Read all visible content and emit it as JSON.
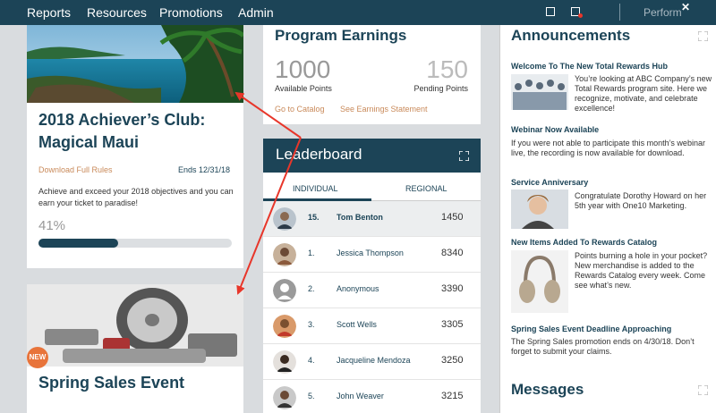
{
  "nav": {
    "items": [
      "Reports",
      "Resources",
      "Promotions",
      "Admin"
    ],
    "brand": "Perform"
  },
  "achiever": {
    "title": "2018 Achiever’s Club: Magical Maui",
    "download_link": "Download Full Rules",
    "ends": "Ends 12/31/18",
    "description": "Achieve and exceed your 2018 objectives and you can earn your ticket to paradise!",
    "percent_label": "41%",
    "progress": 0.41
  },
  "spring_card": {
    "title": "Spring Sales Event",
    "badge": "NEW"
  },
  "earnings": {
    "title": "Program Earnings",
    "available_value": "1000",
    "available_label": "Available Points",
    "pending_value": "150",
    "pending_label": "Pending Points",
    "catalog_link": "Go to Catalog",
    "statement_link": "See Earnings Statement"
  },
  "leaderboard": {
    "title": "Leaderboard",
    "tabs": [
      "INDIVIDUAL",
      "REGIONAL"
    ],
    "rows": [
      {
        "rank": "15.",
        "name": "Tom Benton",
        "points": "1450"
      },
      {
        "rank": "1.",
        "name": "Jessica Thompson",
        "points": "8340"
      },
      {
        "rank": "2.",
        "name": "Anonymous",
        "points": "3390"
      },
      {
        "rank": "3.",
        "name": "Scott Wells",
        "points": "3305"
      },
      {
        "rank": "4.",
        "name": "Jacqueline Mendoza",
        "points": "3250"
      },
      {
        "rank": "5.",
        "name": "John Weaver",
        "points": "3215"
      }
    ]
  },
  "announcements": {
    "title": "Announcements",
    "items": [
      {
        "heading": "Welcome To The New Total Rewards Hub",
        "text": "You’re looking at ABC Company’s new Total Rewards program site. Here we recognize, motivate, and celebrate excellence!"
      },
      {
        "heading": "Webinar Now Available",
        "text": "If you were not able to participate this month’s webinar live, the recording is now available for download."
      },
      {
        "heading": "Service Anniversary",
        "text": "Congratulate Dorothy Howard on her 5th year with One10 Marketing."
      },
      {
        "heading": "New Items Added To Rewards Catalog",
        "text": "Points burning a hole in your pocket? New merchandise is added to the Rewards Catalog every week. Come see what’s new."
      },
      {
        "heading": "Spring Sales Event Deadline Approaching",
        "text": "The Spring Sales promotion ends on 4/30/18. Don’t forget to submit your claims."
      }
    ]
  },
  "messages": {
    "title": "Messages"
  },
  "colors": {
    "brand": "#1c4457",
    "accent_link": "#c98a5a",
    "badge": "#e8743b",
    "annotation_arrow": "#e8362a"
  }
}
